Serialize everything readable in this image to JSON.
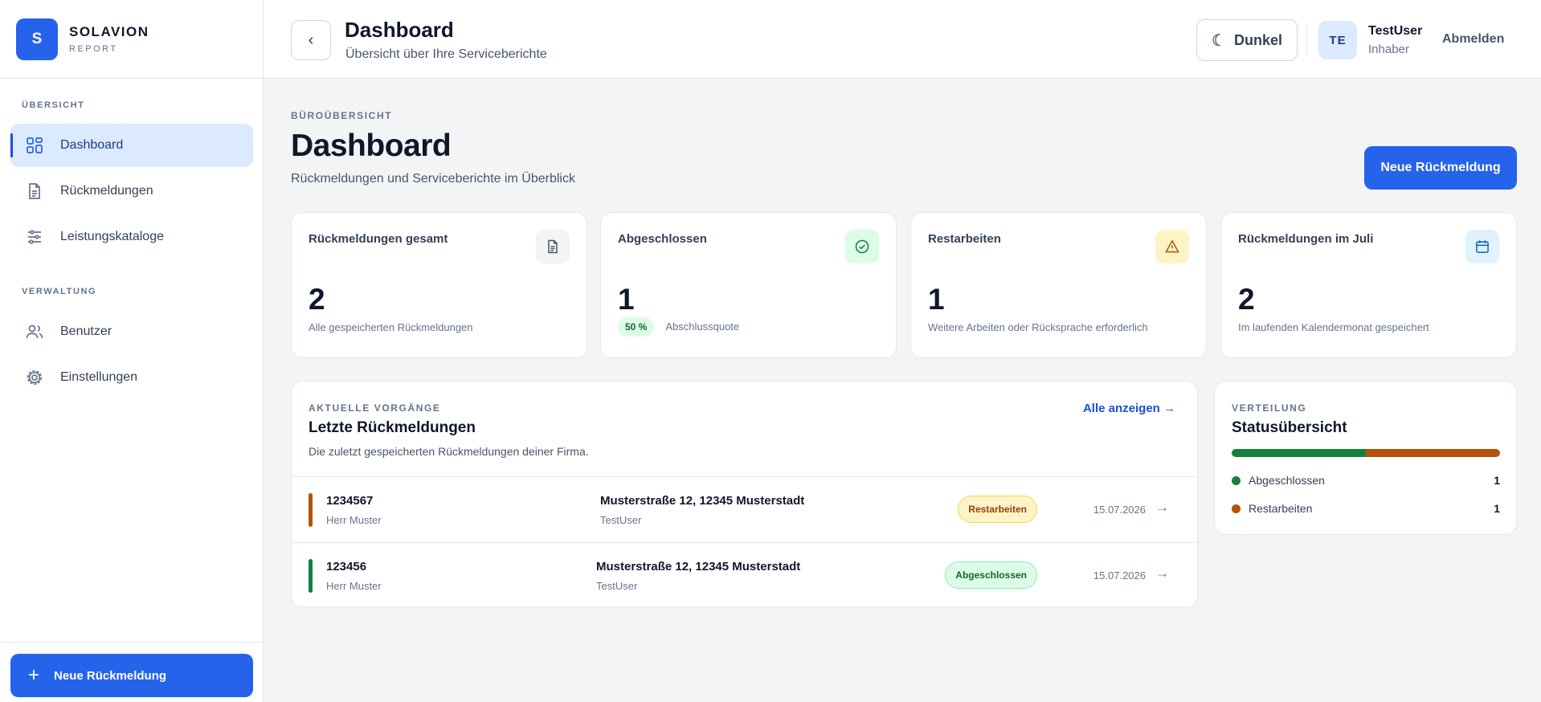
{
  "brand": {
    "logo_letter": "S",
    "name": "SOLAVION",
    "sub": "REPORT"
  },
  "sidebar": {
    "section_overview": "ÜBERSICHT",
    "section_admin": "VERWALTUNG",
    "items": [
      {
        "label": "Dashboard",
        "icon": "dashboard-grid-icon"
      },
      {
        "label": "Rückmeldungen",
        "icon": "document-icon"
      },
      {
        "label": "Leistungskataloge",
        "icon": "sliders-icon"
      },
      {
        "label": "Benutzer",
        "icon": "users-icon"
      },
      {
        "label": "Einstellungen",
        "icon": "gear-icon"
      }
    ],
    "new_button_label": "Neue Rückmeldung"
  },
  "header": {
    "back_glyph": "‹",
    "title": "Dashboard",
    "subtitle": "Übersicht über Ihre Serviceberichte",
    "theme_label": "Dunkel",
    "theme_glyph": "☾",
    "avatar_initials": "TE",
    "user_name": "TestUser",
    "user_role": "Inhaber",
    "logout_label": "Abmelden"
  },
  "main": {
    "eyebrow": "BÜROÜBERSICHT",
    "title": "Dashboard",
    "subtitle": "Rückmeldungen und Serviceberichte im Überblick",
    "new_button_label": "Neue Rückmeldung"
  },
  "stats": [
    {
      "label": "Rückmeldungen gesamt",
      "value": "2",
      "note": "Alle gespeicherten Rückmeldungen",
      "icon": "document-icon"
    },
    {
      "label": "Abgeschlossen",
      "value": "1",
      "percent": "50 %",
      "note": "Abschlussquote",
      "icon": "check-circle-icon"
    },
    {
      "label": "Restarbeiten",
      "value": "1",
      "note": "Weitere Arbeiten oder Rücksprache erforderlich",
      "icon": "warning-triangle-icon"
    },
    {
      "label": "Rückmeldungen im Juli",
      "value": "2",
      "note": "Im laufenden Kalendermonat gespeichert",
      "icon": "calendar-icon"
    }
  ],
  "recent": {
    "eyebrow": "AKTUELLE VORGÄNGE",
    "title": "Letzte Rückmeldungen",
    "description": "Die zuletzt gespeicherten Rückmeldungen deiner Firma.",
    "see_all": "Alle anzeigen →",
    "row_arrow": "→",
    "rows": [
      {
        "id": "1234567",
        "person": "Herr Muster",
        "address": "Musterstraße 12, 12345 Musterstadt",
        "user": "TestUser",
        "status": "Restarbeiten",
        "date": "15.07.2026"
      },
      {
        "id": "123456",
        "person": "Herr Muster",
        "address": "Musterstraße 12, 12345 Musterstadt",
        "user": "TestUser",
        "status": "Abgeschlossen",
        "date": "15.07.2026"
      }
    ]
  },
  "status_overview": {
    "eyebrow": "VERTEILUNG",
    "title": "Statusübersicht",
    "items": [
      {
        "label": "Abgeschlossen",
        "count": "1",
        "share": 0.5,
        "color": "#15803d"
      },
      {
        "label": "Restarbeiten",
        "count": "1",
        "share": 0.5,
        "color": "#b45309"
      }
    ]
  },
  "colors": {
    "accent": "#2563eb",
    "done": "#15803d",
    "rest": "#b45309"
  }
}
